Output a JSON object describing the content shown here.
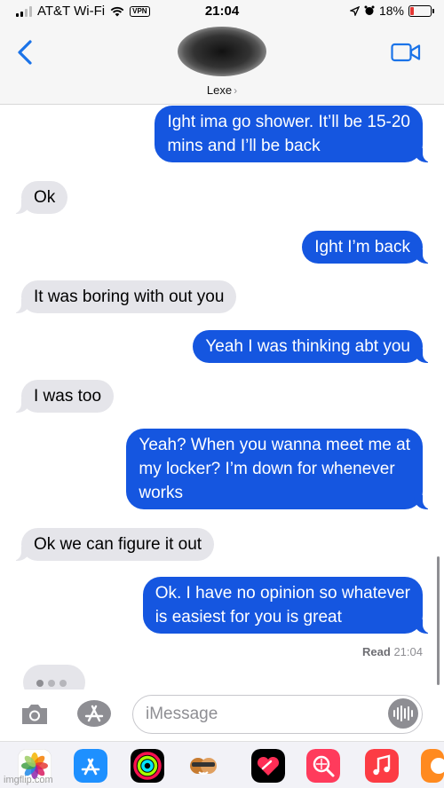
{
  "status_bar": {
    "carrier": "AT&T Wi-Fi",
    "vpn": "VPN",
    "time": "21:04",
    "battery_percent": "18%"
  },
  "header": {
    "contact_name": "Lexe",
    "contact_chevron": "›",
    "icons": [
      "back-chevron-icon",
      "video-camera-icon"
    ]
  },
  "messages": [
    {
      "side": "sent",
      "text": "Ight ima go shower. It’ll be 15-20\nmins and I’ll be back"
    },
    {
      "side": "recv",
      "text": "Ok"
    },
    {
      "side": "sent",
      "text": "Ight I’m back"
    },
    {
      "side": "recv",
      "text": "It was boring with out you"
    },
    {
      "side": "sent",
      "text": "Yeah I was thinking abt you"
    },
    {
      "side": "recv",
      "text": "I was too"
    },
    {
      "side": "sent",
      "text": "Yeah? When you wanna meet me at\nmy locker? I’m down for whenever\nworks"
    },
    {
      "side": "recv",
      "text": "Ok we can figure it out"
    },
    {
      "side": "sent",
      "text": "Ok. I have no opinion so whatever\nis easiest for you is great"
    }
  ],
  "read_receipt": {
    "label": "Read",
    "time": "21:04"
  },
  "input": {
    "placeholder": "iMessage"
  },
  "app_drawer": [
    "photos-icon",
    "app-store-icon",
    "activity-icon",
    "memoji-icon",
    "digital-touch-icon",
    "search-images-icon",
    "music-icon",
    "partial-app-icon"
  ],
  "watermark": "imgflip.com",
  "colors": {
    "sent": "#1556e0",
    "received": "#e5e5ea",
    "accent": "#1a73e8"
  }
}
